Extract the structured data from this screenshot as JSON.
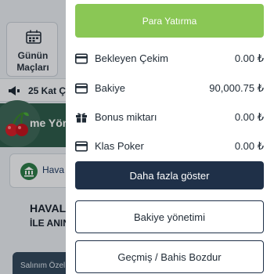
{
  "background": {
    "tile_label": "Günün\nMaçları",
    "strip_text": "25 Kat Ç",
    "banner_text": "me Yön",
    "card_text": "Hava",
    "info_title": "HAVAL",
    "info_sub": "İLE ANIND",
    "bottom_text": "Salınım Özel E"
  },
  "drawer": {
    "deposit_label": "Para Yatırma",
    "rows": [
      {
        "label": "Bekleyen Çekim",
        "value": "0.00 ₺",
        "icon": "card-icon"
      },
      {
        "label": "Bakiye",
        "value": "90,000.75 ₺",
        "icon": "card-icon"
      },
      {
        "label": "Bonus miktarı",
        "value": "0.00 ₺",
        "icon": "gift-icon"
      },
      {
        "label": "Klas Poker",
        "value": "0.00 ₺",
        "icon": "card-icon"
      }
    ],
    "more_label": "Daha fazla göster",
    "balance_mgmt_label": "Bakiye yönetimi",
    "history_label": "Geçmiş / Bahis Bozdur"
  },
  "colors": {
    "deposit_green": "#8ac755",
    "navy": "#1f3048",
    "text_dark": "#1f2a35"
  }
}
